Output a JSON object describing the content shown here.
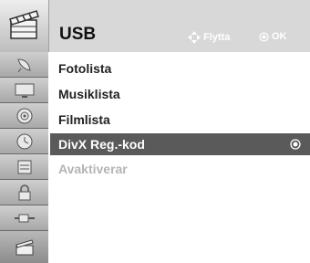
{
  "header": {
    "title": "USB",
    "hint_move": "Flytta",
    "hint_ok": "OK",
    "icon": "usb-clapper-icon"
  },
  "sidebar": {
    "items": [
      {
        "icon": "satellite-dish-icon"
      },
      {
        "icon": "monitor-icon"
      },
      {
        "icon": "speaker-icon"
      },
      {
        "icon": "clock-icon"
      },
      {
        "icon": "options-icon"
      },
      {
        "icon": "lock-icon"
      },
      {
        "icon": "input-cable-icon"
      },
      {
        "icon": "usb-clapper-icon",
        "active": true
      }
    ]
  },
  "menu": {
    "items": [
      {
        "label": "Fotolista"
      },
      {
        "label": "Musiklista"
      },
      {
        "label": "Filmlista"
      },
      {
        "label": "DivX Reg.-kod",
        "selected": true
      },
      {
        "label": "Avaktiverar",
        "disabled": true
      }
    ]
  },
  "colors": {
    "selected_bg": "#5a5a5a",
    "disabled_text": "#b4b4b4",
    "header_bg": "#d8d8d8",
    "sidebar_bg": "#a8a8a8"
  }
}
